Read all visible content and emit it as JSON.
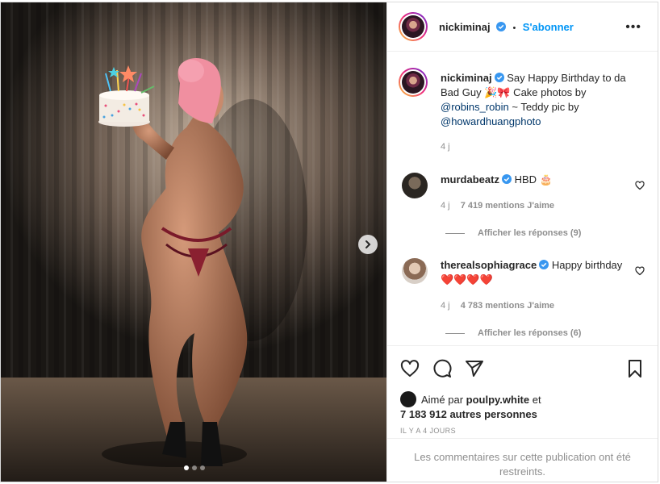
{
  "post": {
    "carousel": {
      "current_index": 1,
      "total": 3
    },
    "author": "nickiminaj",
    "follow_label": "S'abonner",
    "more_label": "•••",
    "separator": "•"
  },
  "caption": {
    "username": "nickiminaj",
    "text_1": "Say Happy Birthday to da Bad Guy 🎉🎀 Cake photos by ",
    "mention_1": "@robins_robin",
    "text_2": " ~ Teddy pic by ",
    "mention_2": "@howardhuangphoto",
    "time": "4 j"
  },
  "comments": [
    {
      "username": "murdabeatz",
      "text": "HBD 🎂",
      "time": "4 j",
      "likes": "7 419 mentions J'aime",
      "replies": "Afficher les réponses (9)"
    },
    {
      "username": "therealsophiagrace",
      "text": "Happy birthday ❤️❤️❤️❤️",
      "time": "4 j",
      "likes": "4 783 mentions J'aime",
      "replies": "Afficher les réponses (6)"
    }
  ],
  "likes": {
    "prefix": "Aimé par ",
    "user": "poulpy.white",
    "mid": " et",
    "others": "7 183 912 autres personnes"
  },
  "date_label": "IL Y A 4 JOURS",
  "restricted_notice": "Les commentaires sur cette publication ont été restreints.",
  "colors": {
    "accent": "#0095f6",
    "verified": "#3897f0",
    "text": "#262626",
    "muted": "#8e8e8e"
  },
  "icons": [
    "heart-icon",
    "comment-icon",
    "share-icon",
    "bookmark-icon",
    "chevron-right-icon",
    "verified-icon",
    "more-icon"
  ]
}
